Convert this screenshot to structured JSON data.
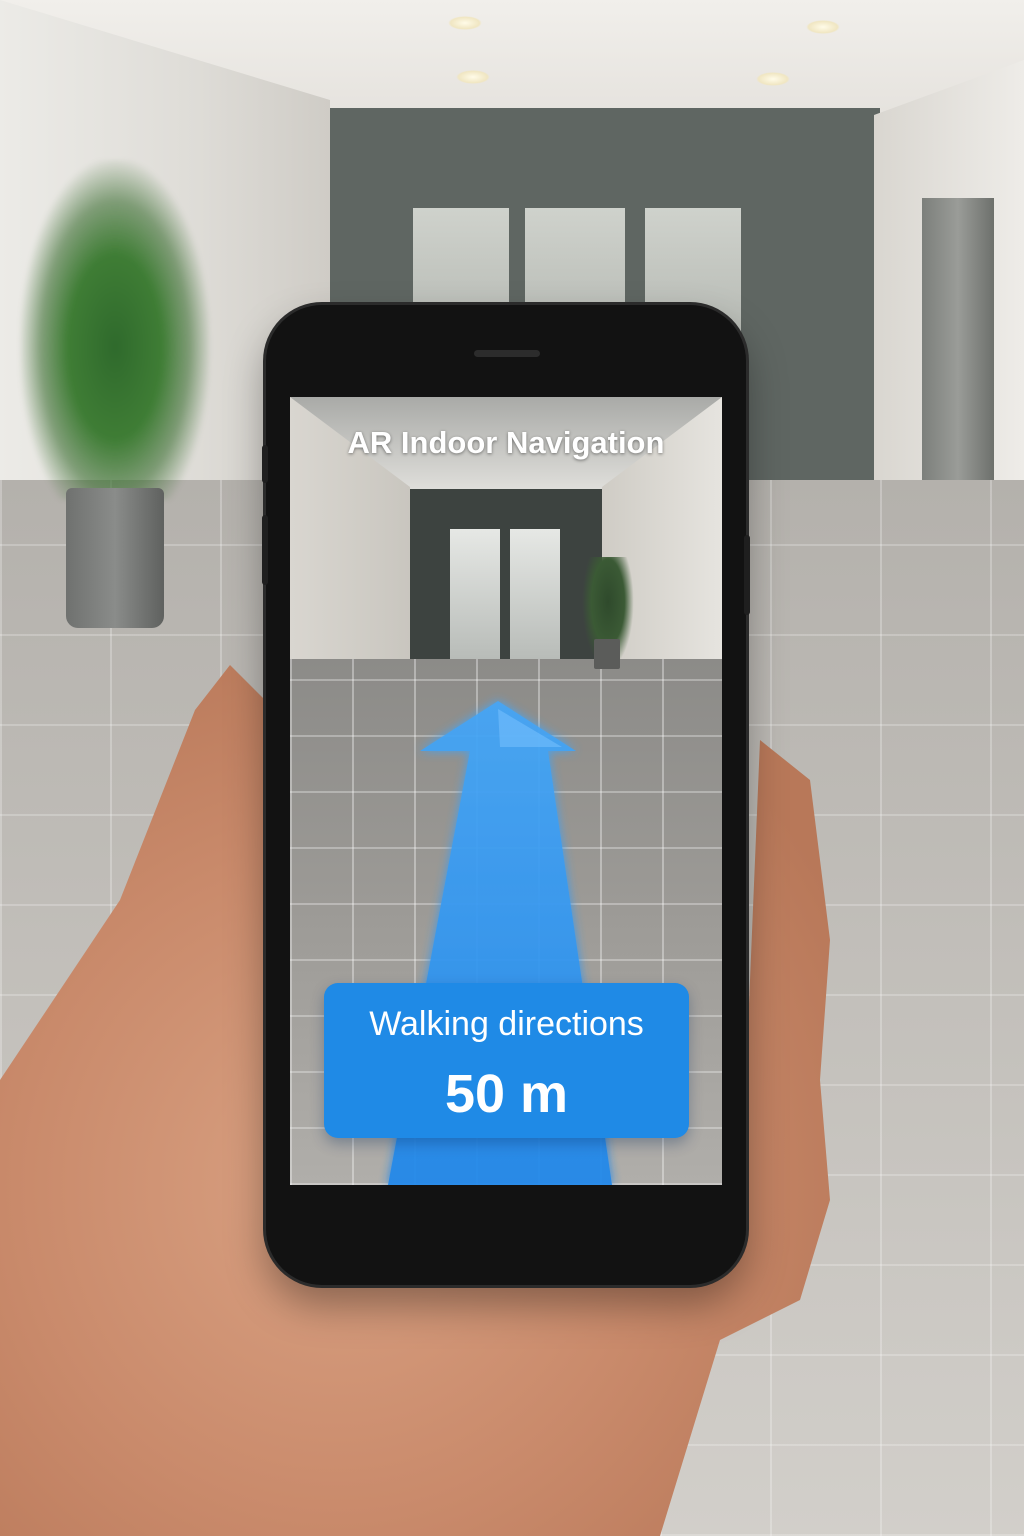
{
  "app": {
    "title": "AR Indoor Navigation"
  },
  "directions_card": {
    "label": "Walking directions",
    "distance": "50 m"
  },
  "colors": {
    "accent": "#1f8ae6",
    "arrow": "#2f93ef",
    "phone_body": "#121212"
  },
  "icons": {
    "direction": "arrow-up-icon"
  }
}
